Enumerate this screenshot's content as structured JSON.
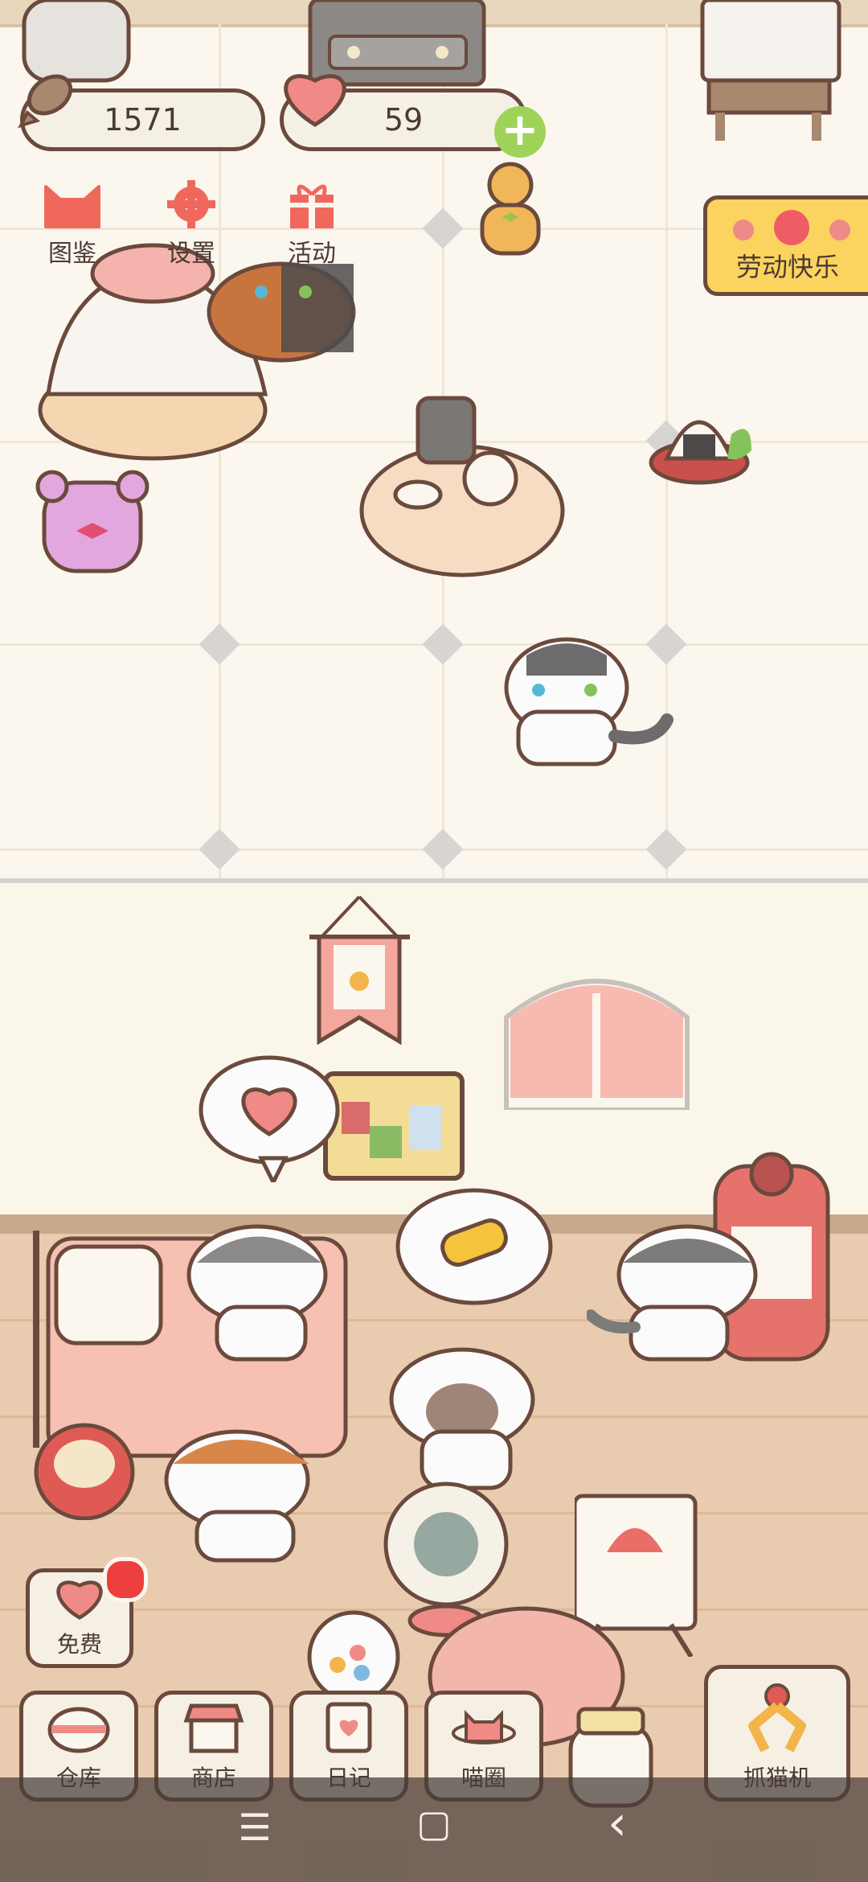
{
  "hud": {
    "coins": "1571",
    "hearts": "59",
    "add_hearts_symbol": "+"
  },
  "top_menu": [
    {
      "label": "图鉴",
      "icon": "cat-face-icon"
    },
    {
      "label": "设置",
      "icon": "gear-icon"
    },
    {
      "label": "活动",
      "icon": "gift-icon"
    }
  ],
  "event_banner": {
    "label": "劳动快乐"
  },
  "free_button": {
    "label": "免费"
  },
  "bottom_nav": [
    {
      "label": "仓库",
      "icon": "storage-icon"
    },
    {
      "label": "商店",
      "icon": "shop-icon"
    },
    {
      "label": "日记",
      "icon": "diary-icon"
    },
    {
      "label": "喵圈",
      "icon": "cat-planet-icon"
    }
  ],
  "claw_machine": {
    "label": "抓猫机",
    "icon": "claw-icon"
  },
  "system_nav": {
    "menu": "☰",
    "home": "▢",
    "back": "‹"
  },
  "colors": {
    "outline": "#6b4a3d",
    "accent_red": "#f0685c",
    "heart_pink": "#f08a86",
    "plus_green": "#9ed35a",
    "banner_yellow": "#fbd35f",
    "notification_red": "#ee3f3f"
  }
}
